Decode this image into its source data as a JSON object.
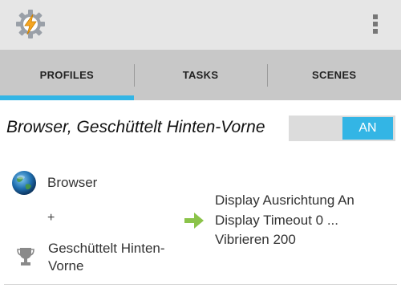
{
  "app": {
    "icon": "tasker-lightning-gear-icon"
  },
  "action_bar": {
    "overflow_icon": "overflow-menu-icon"
  },
  "tabs": [
    {
      "label": "PROFILES",
      "active": true
    },
    {
      "label": "TASKS",
      "active": false
    },
    {
      "label": "SCENES",
      "active": false
    }
  ],
  "profile": {
    "name": "Browser, Geschüttelt Hinten-Vorne",
    "toggle_label": "AN",
    "contexts": [
      {
        "icon": "globe-icon",
        "label": "Browser"
      },
      {
        "icon": "trophy-icon",
        "label": "Geschüttelt Hinten-Vorne"
      }
    ],
    "context_joiner": "+",
    "task_arrow_icon": "arrow-right-icon",
    "tasks": [
      "Display Ausrichtung An",
      "Display Timeout 0 ...",
      "Vibrieren 200"
    ]
  },
  "colors": {
    "accent": "#33b5e5",
    "action_bar": "#e6e6e6",
    "tab_bar": "#c8c8c8",
    "arrow": "#8bc34a"
  }
}
